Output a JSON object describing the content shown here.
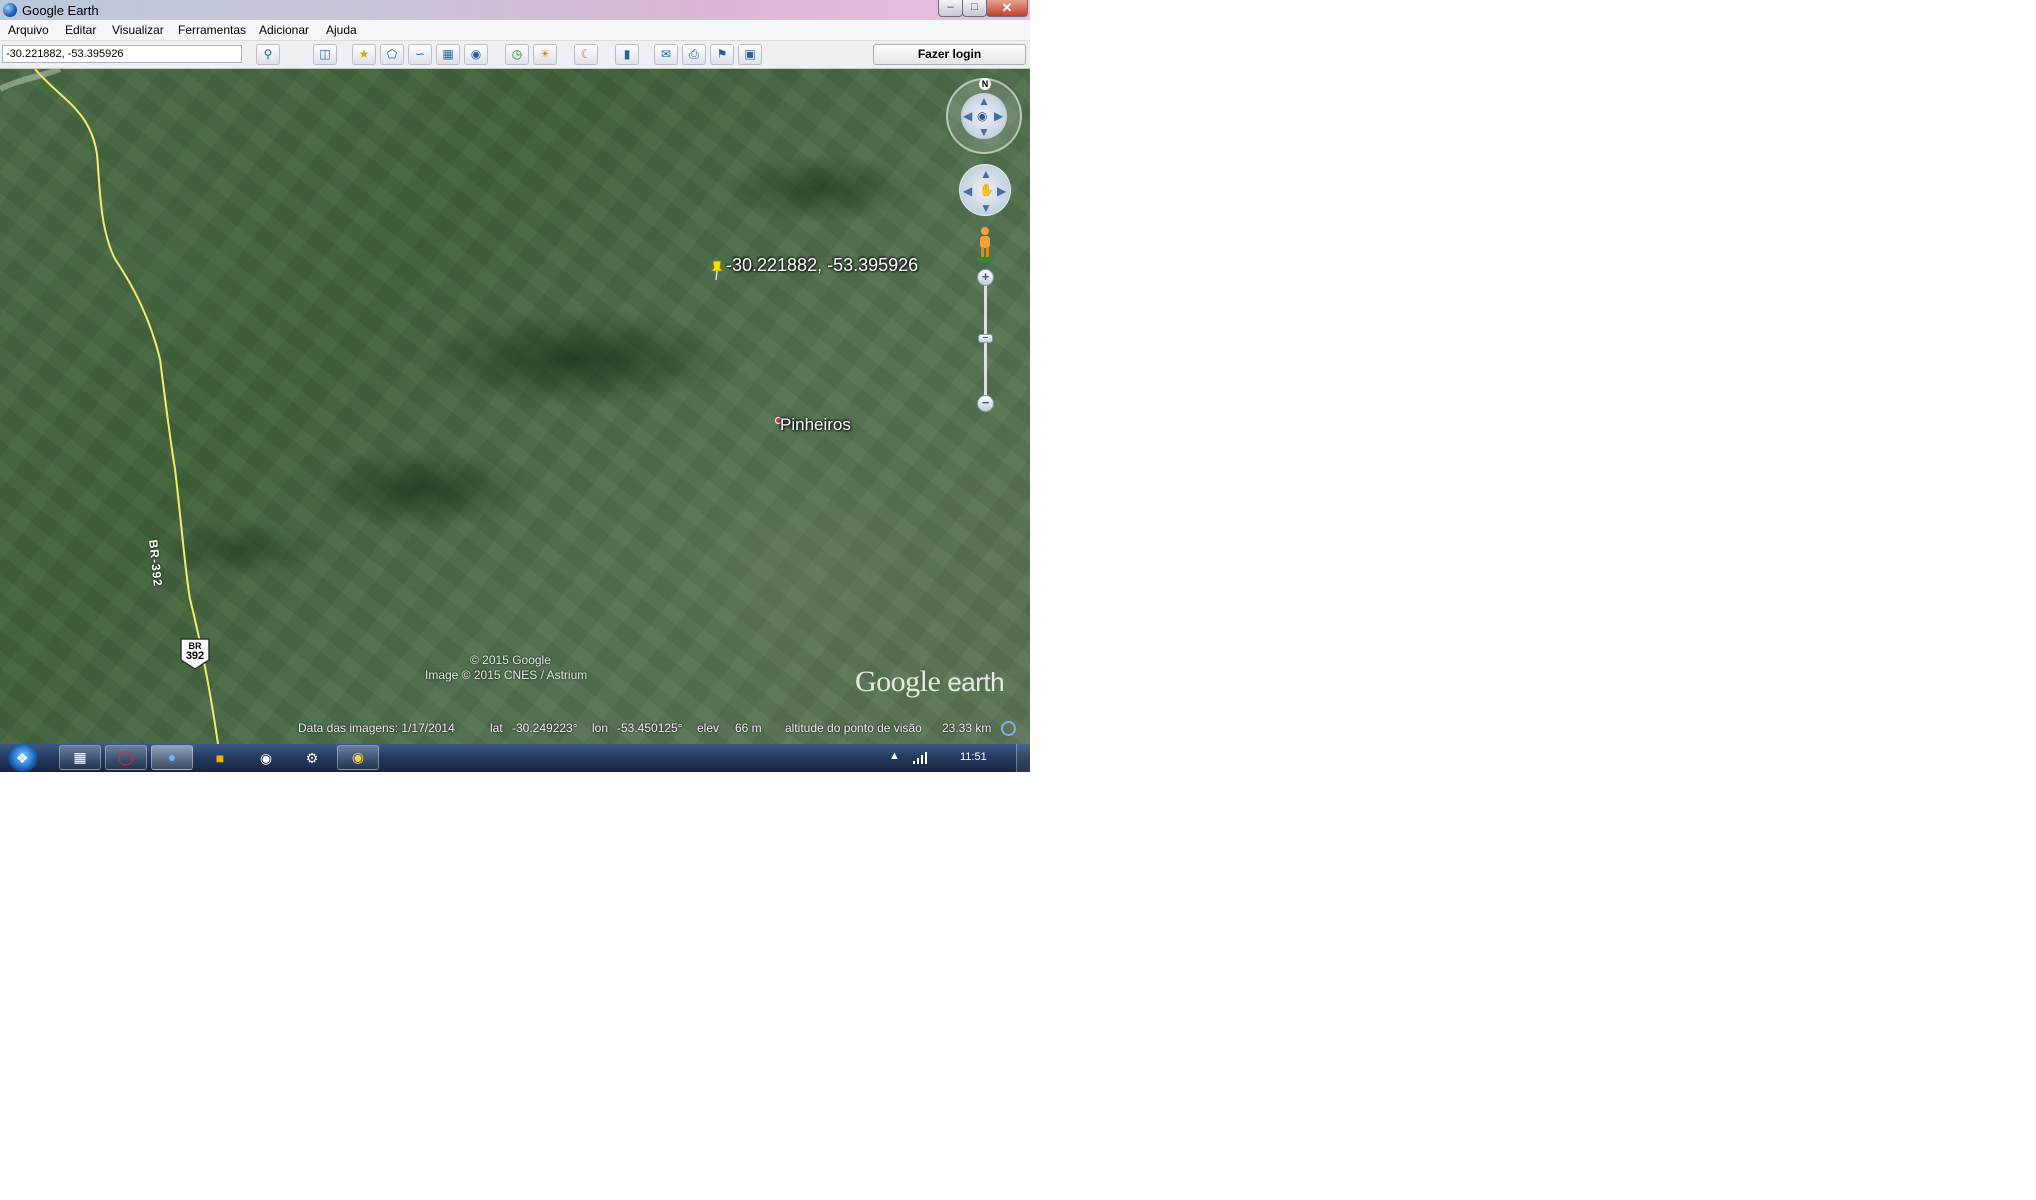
{
  "window": {
    "title": "Google Earth",
    "minimize_glyph": "–",
    "maximize_glyph": "□",
    "close_glyph": "✕"
  },
  "menu": [
    "Arquivo",
    "Editar",
    "Visualizar",
    "Ferramentas",
    "Adicionar",
    "Ajuda"
  ],
  "toolbar": {
    "search_value": "-30.221882, -53.395926",
    "login_label": "Fazer login",
    "icons": [
      "search-icon",
      "sidebar-toggle-icon",
      "add-placemark-icon",
      "add-polygon-icon",
      "add-path-icon",
      "add-overlay-icon",
      "record-tour-icon",
      "historical-imagery-icon",
      "sunlight-icon",
      "planets-icon",
      "ruler-icon",
      "email-icon",
      "print-icon",
      "save-image-icon",
      "view-in-maps-icon"
    ]
  },
  "map": {
    "placemark_label": "-30.221882, -53.395926",
    "town_label": "Pinheiros",
    "road_label": "BR-392",
    "shield_top": "BR",
    "shield_number": "392",
    "copyright_line1": "© 2015 Google",
    "copyright_line2": "Image © 2015 CNES / Astrium",
    "logo_google": "Google",
    "logo_earth": "earth"
  },
  "status": {
    "imagery_date": "Data das imagens: 1/17/2014",
    "lat_label": "lat",
    "lat_value": "-30.249223°",
    "lon_label": "lon",
    "lon_value": "-53.450125°",
    "elev_label": "elev",
    "elev_value": "66 m",
    "eye_alt_label": "altitude do ponto de visão",
    "eye_alt_value": "23.33 km"
  },
  "nav": {
    "north_label": "N",
    "zoom_in": "+",
    "zoom_out": "−"
  },
  "taskbar": {
    "clock": "11:51",
    "tray_arrow": "▲"
  },
  "colors": {
    "road": "#f2ec6a",
    "placemark": "#f5e10a",
    "town_dot": "#dd3333"
  }
}
